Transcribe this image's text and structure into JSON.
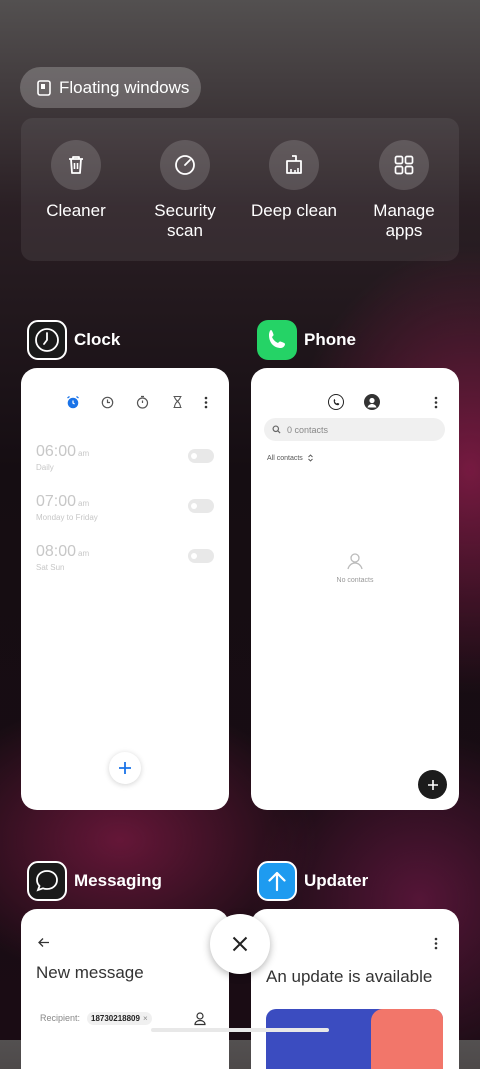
{
  "floating_windows": {
    "label": "Floating windows"
  },
  "quick_actions": [
    {
      "label": "Cleaner",
      "icon": "trash-icon"
    },
    {
      "label": "Security scan",
      "icon": "security-scan-icon"
    },
    {
      "label": "Deep clean",
      "icon": "deep-clean-icon"
    },
    {
      "label": "Manage apps",
      "icon": "manage-apps-icon"
    }
  ],
  "apps": {
    "clock": {
      "name": "Clock",
      "alarms": [
        {
          "time": "06:00",
          "ampm": "am",
          "repeat": "Daily"
        },
        {
          "time": "07:00",
          "ampm": "am",
          "repeat": "Monday to Friday"
        },
        {
          "time": "08:00",
          "ampm": "am",
          "repeat": "Sat Sun"
        }
      ]
    },
    "phone": {
      "name": "Phone",
      "search_placeholder": "0 contacts",
      "filter": "All contacts",
      "empty": "No contacts"
    },
    "messaging": {
      "name": "Messaging",
      "title": "New message",
      "recipient_label": "Recipient:",
      "recipient_chip": "18730218809"
    },
    "updater": {
      "name": "Updater",
      "title": "An update is available"
    }
  },
  "colors": {
    "phone_icon_bg": "#25d366",
    "updater_icon_bg": "#1e9bf0",
    "clock_accent": "#1a73e8"
  }
}
